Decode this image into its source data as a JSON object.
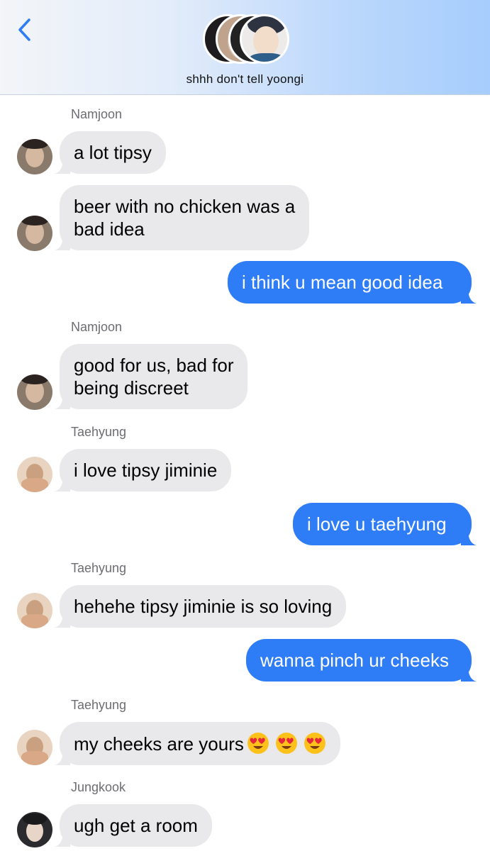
{
  "header": {
    "group_name": "shhh don't tell yoongi",
    "accent": "#2e7cf6"
  },
  "senders": {
    "s1": "Namjoon",
    "s2": "Namjoon",
    "s3": "Taehyung",
    "s4": "Taehyung",
    "s5": "Taehyung",
    "s6": "Jungkook"
  },
  "messages": {
    "m1": "a lot tipsy",
    "m2_l1": "beer with no chicken was a",
    "m2_l2": "bad idea",
    "m3": "i think u mean good idea",
    "m4_l1": "good for us, bad for",
    "m4_l2": "being discreet",
    "m5": "i love tipsy jiminie",
    "m6": "i love u taehyung",
    "m7": "hehehe tipsy jiminie is so loving",
    "m8": "wanna pinch ur cheeks",
    "m9": "my cheeks are yours",
    "m10": "ugh get a room"
  },
  "colors": {
    "incoming_bubble": "#e9e9eb",
    "outgoing_bubble": "#2e7cf6"
  }
}
